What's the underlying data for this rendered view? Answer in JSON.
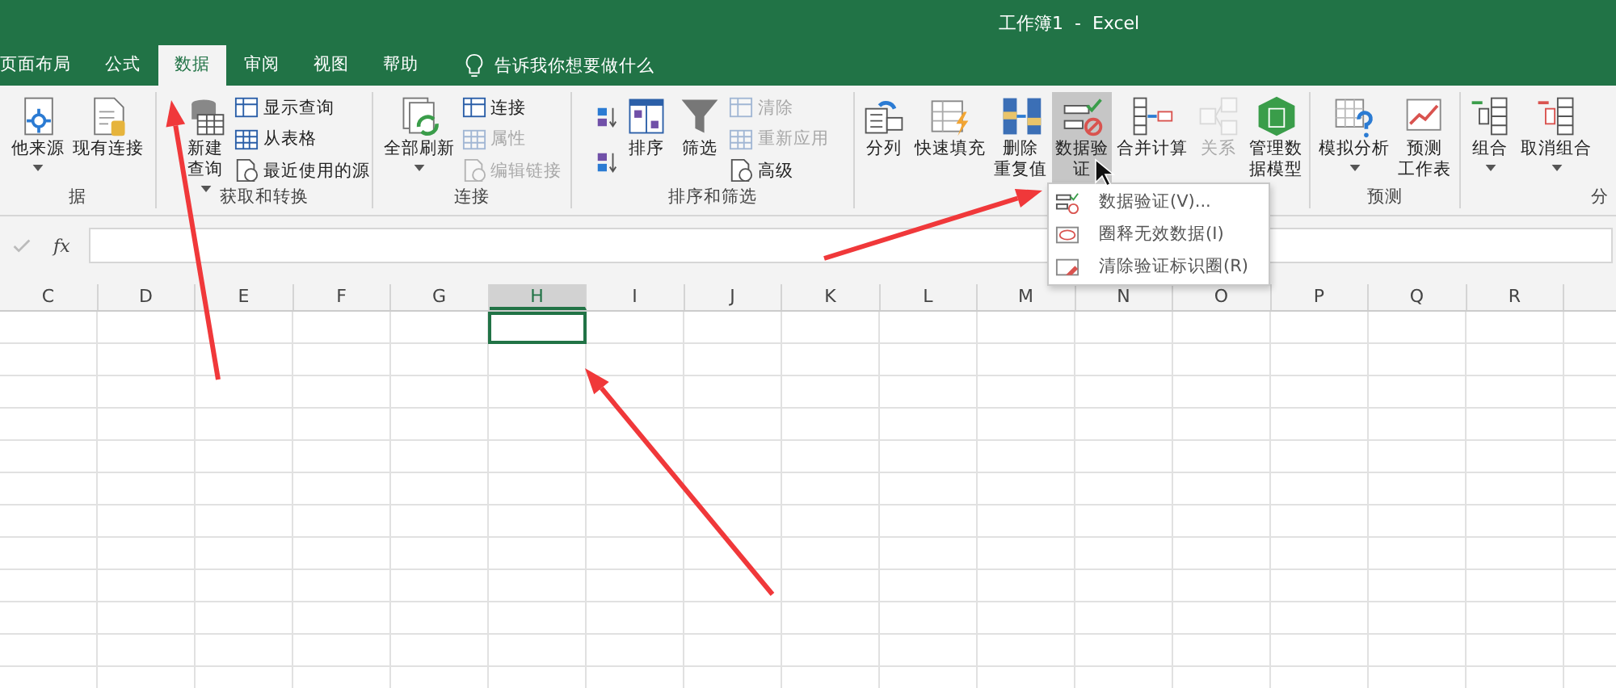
{
  "window": {
    "title": "工作簿1  -  Excel"
  },
  "tabs": [
    {
      "label": "页面布局",
      "selected": false
    },
    {
      "label": "公式",
      "selected": false
    },
    {
      "label": "数据",
      "selected": true
    },
    {
      "label": "审阅",
      "selected": false
    },
    {
      "label": "视图",
      "selected": false
    },
    {
      "label": "帮助",
      "selected": false
    }
  ],
  "tell_me": {
    "placeholder": "告诉我你想要做什么"
  },
  "ribbon_groups": [
    {
      "label": "据",
      "items": [
        {
          "kind": "large",
          "lines": [
            "他来源"
          ],
          "dropdown": true,
          "disabled": false,
          "active": false
        },
        {
          "kind": "large",
          "lines": [
            "现有连接"
          ],
          "dropdown": false,
          "disabled": false,
          "active": false
        }
      ]
    },
    {
      "label": "获取和转换",
      "items": [
        {
          "kind": "large",
          "lines": [
            "新建",
            "查询"
          ],
          "dropdown": true,
          "disabled": false,
          "active": false
        },
        {
          "kind": "stack",
          "items": [
            {
              "label": "显示查询",
              "disabled": false
            },
            {
              "label": "从表格",
              "disabled": false
            },
            {
              "label": "最近使用的源",
              "disabled": false
            }
          ]
        }
      ]
    },
    {
      "label": "连接",
      "items": [
        {
          "kind": "large",
          "lines": [
            "全部刷新"
          ],
          "dropdown": true,
          "disabled": false,
          "active": false
        },
        {
          "kind": "stack",
          "items": [
            {
              "label": "连接",
              "disabled": false
            },
            {
              "label": "属性",
              "disabled": true
            },
            {
              "label": "编辑链接",
              "disabled": true
            }
          ]
        }
      ]
    },
    {
      "label": "排序和筛选",
      "items": [
        {
          "kind": "sorticons"
        },
        {
          "kind": "large",
          "lines": [
            "排序"
          ],
          "dropdown": false,
          "disabled": false,
          "active": false
        },
        {
          "kind": "large",
          "lines": [
            "筛选"
          ],
          "dropdown": false,
          "disabled": false,
          "active": false
        },
        {
          "kind": "stack",
          "items": [
            {
              "label": "清除",
              "disabled": true
            },
            {
              "label": "重新应用",
              "disabled": true
            },
            {
              "label": "高级",
              "disabled": false
            }
          ]
        }
      ]
    },
    {
      "items": [
        {
          "kind": "large",
          "lines": [
            "分列"
          ],
          "dropdown": false,
          "disabled": false,
          "active": false
        },
        {
          "kind": "large",
          "lines": [
            "快速填充"
          ],
          "dropdown": false,
          "disabled": false,
          "active": false
        },
        {
          "kind": "large",
          "lines": [
            "删除",
            "重复值"
          ],
          "dropdown": false,
          "disabled": false,
          "active": false
        },
        {
          "kind": "large",
          "lines": [
            "数据验",
            "证"
          ],
          "dropdown": true,
          "disabled": false,
          "active": true
        },
        {
          "kind": "large",
          "lines": [
            "合并计算"
          ],
          "dropdown": false,
          "disabled": false,
          "active": false
        },
        {
          "kind": "large",
          "lines": [
            "关系"
          ],
          "dropdown": false,
          "disabled": true,
          "active": false
        },
        {
          "kind": "large",
          "lines": [
            "管理数",
            "据模型"
          ],
          "dropdown": false,
          "disabled": false,
          "active": false
        }
      ]
    },
    {
      "label": "预测",
      "items": [
        {
          "kind": "large",
          "lines": [
            "模拟分析"
          ],
          "dropdown": true,
          "disabled": false,
          "active": false
        },
        {
          "kind": "large",
          "lines": [
            "预测",
            "工作表"
          ],
          "dropdown": false,
          "disabled": false,
          "active": false
        }
      ]
    },
    {
      "label": "分",
      "items": [
        {
          "kind": "large",
          "lines": [
            "组合"
          ],
          "dropdown": true,
          "disabled": false,
          "active": false
        },
        {
          "kind": "large",
          "lines": [
            "取消组合"
          ],
          "dropdown": true,
          "disabled": false,
          "active": false
        }
      ]
    }
  ],
  "formula_bar": {
    "fx": "fx"
  },
  "columns": [
    {
      "label": "C",
      "selected": false
    },
    {
      "label": "D",
      "selected": false
    },
    {
      "label": "E",
      "selected": false
    },
    {
      "label": "F",
      "selected": false
    },
    {
      "label": "G",
      "selected": false
    },
    {
      "label": "H",
      "selected": true
    },
    {
      "label": "I",
      "selected": false
    },
    {
      "label": "J",
      "selected": false
    },
    {
      "label": "K",
      "selected": false
    },
    {
      "label": "L",
      "selected": false
    },
    {
      "label": "M",
      "selected": false
    },
    {
      "label": "N",
      "selected": false
    },
    {
      "label": "O",
      "selected": false
    },
    {
      "label": "P",
      "selected": false
    },
    {
      "label": "Q",
      "selected": false
    },
    {
      "label": "R",
      "selected": false
    }
  ],
  "dropdown_menu": {
    "items": [
      {
        "label": "数据验证(V)..."
      },
      {
        "label": "圈释无效数据(I)"
      },
      {
        "label": "清除验证标识圈(R)"
      }
    ]
  }
}
